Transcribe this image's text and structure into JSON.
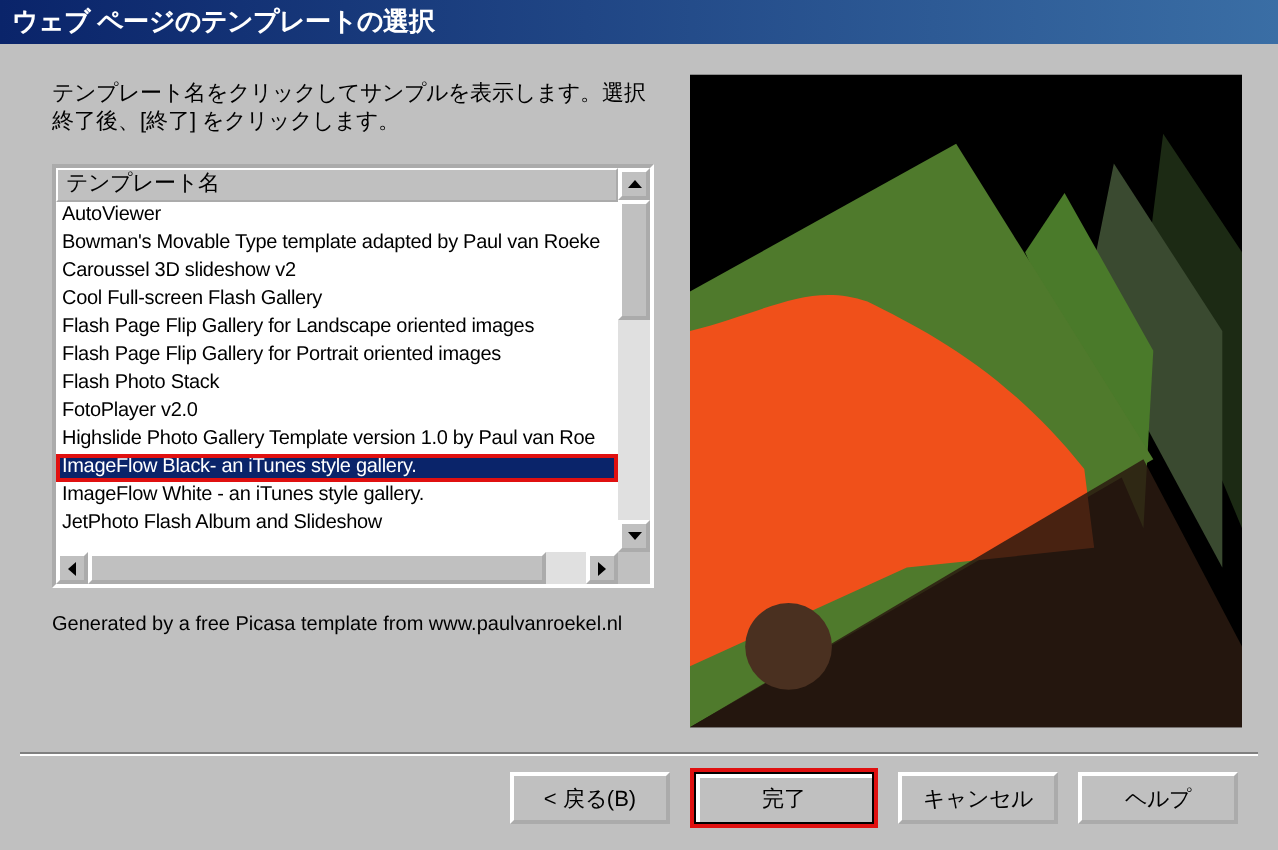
{
  "window": {
    "title": "ウェブ ページのテンプレートの選択"
  },
  "instruction": "テンプレート名をクリックしてサンプルを表示します。選択終了後、[終了] をクリックします。",
  "template_list": {
    "header": "テンプレート名",
    "items": [
      {
        "label": "AutoViewer",
        "selected": false,
        "highlighted": false
      },
      {
        "label": "Bowman's Movable Type template adapted by Paul van Roeke",
        "selected": false,
        "highlighted": false
      },
      {
        "label": "Caroussel 3D slideshow v2",
        "selected": false,
        "highlighted": false
      },
      {
        "label": "Cool Full-screen Flash Gallery",
        "selected": false,
        "highlighted": false
      },
      {
        "label": "Flash Page Flip Gallery for Landscape oriented images",
        "selected": false,
        "highlighted": false
      },
      {
        "label": "Flash Page Flip Gallery for Portrait oriented images",
        "selected": false,
        "highlighted": false
      },
      {
        "label": "Flash Photo Stack",
        "selected": false,
        "highlighted": false
      },
      {
        "label": "FotoPlayer v2.0",
        "selected": false,
        "highlighted": false
      },
      {
        "label": "Highslide Photo Gallery Template version 1.0 by Paul van Roe",
        "selected": false,
        "highlighted": false
      },
      {
        "label": "ImageFlow Black-  an iTunes style gallery.",
        "selected": true,
        "highlighted": true
      },
      {
        "label": "ImageFlow White -  an iTunes style gallery.",
        "selected": false,
        "highlighted": false
      },
      {
        "label": "JetPhoto Flash Album and Slideshow",
        "selected": false,
        "highlighted": false
      }
    ]
  },
  "credit": "Generated by a free Picasa template from www.paulvanroekel.nl",
  "buttons": [
    {
      "label": "< 戻る(B)",
      "default": false,
      "highlighted": false
    },
    {
      "label": "完了",
      "default": true,
      "highlighted": true
    },
    {
      "label": "キャンセル",
      "default": false,
      "highlighted": false
    },
    {
      "label": "ヘルプ",
      "default": false,
      "highlighted": false
    }
  ]
}
